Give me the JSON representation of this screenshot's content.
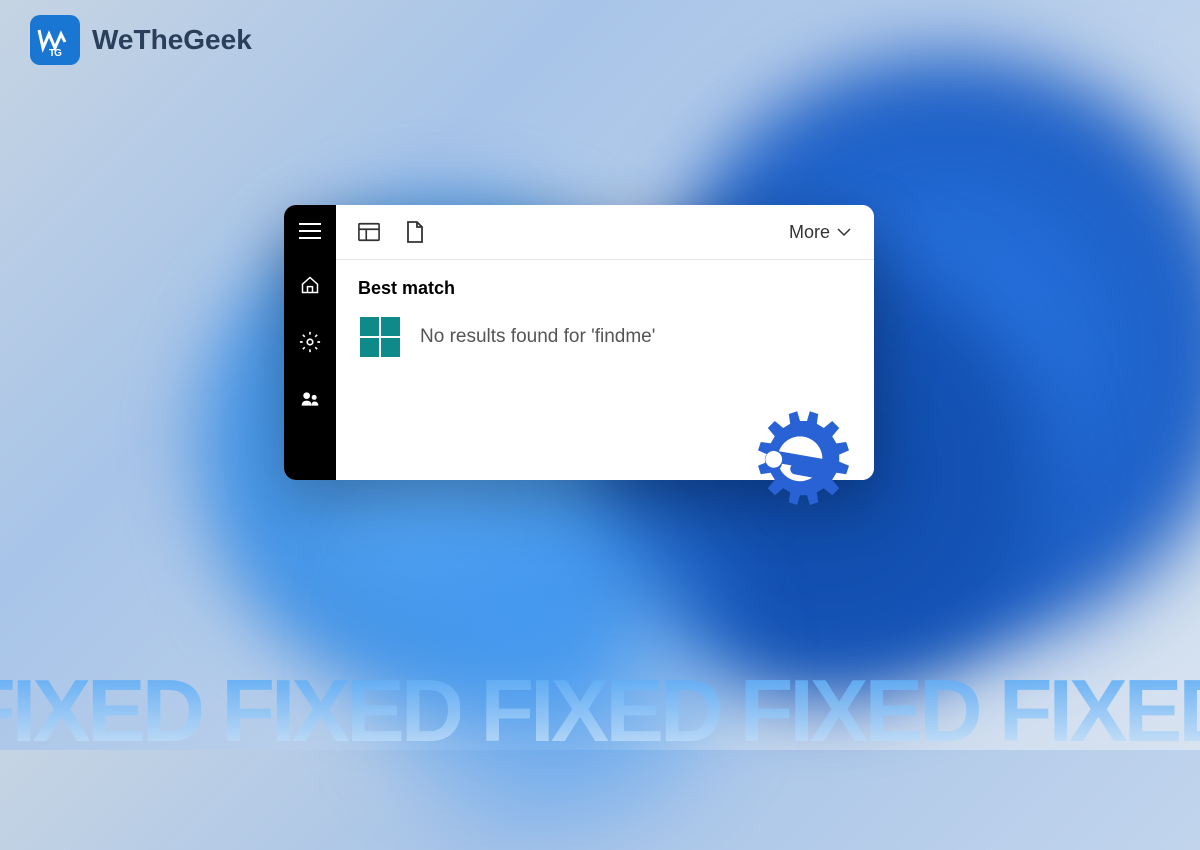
{
  "logo": {
    "badge_text": "WTG",
    "brand_text": "WeTheGeek"
  },
  "search_panel": {
    "sidebar": {
      "icons": [
        "hamburger",
        "home",
        "settings",
        "people"
      ]
    },
    "top_bar": {
      "more_label": "More"
    },
    "content": {
      "section_label": "Best match",
      "result_text": "No results found for 'findme'"
    }
  },
  "banner": {
    "words": [
      "FIXED",
      "FIXED",
      "FIXED",
      "FIXED",
      "FIXED"
    ]
  },
  "colors": {
    "accent": "#1976d2",
    "windows_logo": "#0f8a8a",
    "fix_icon": "#2962d4"
  }
}
